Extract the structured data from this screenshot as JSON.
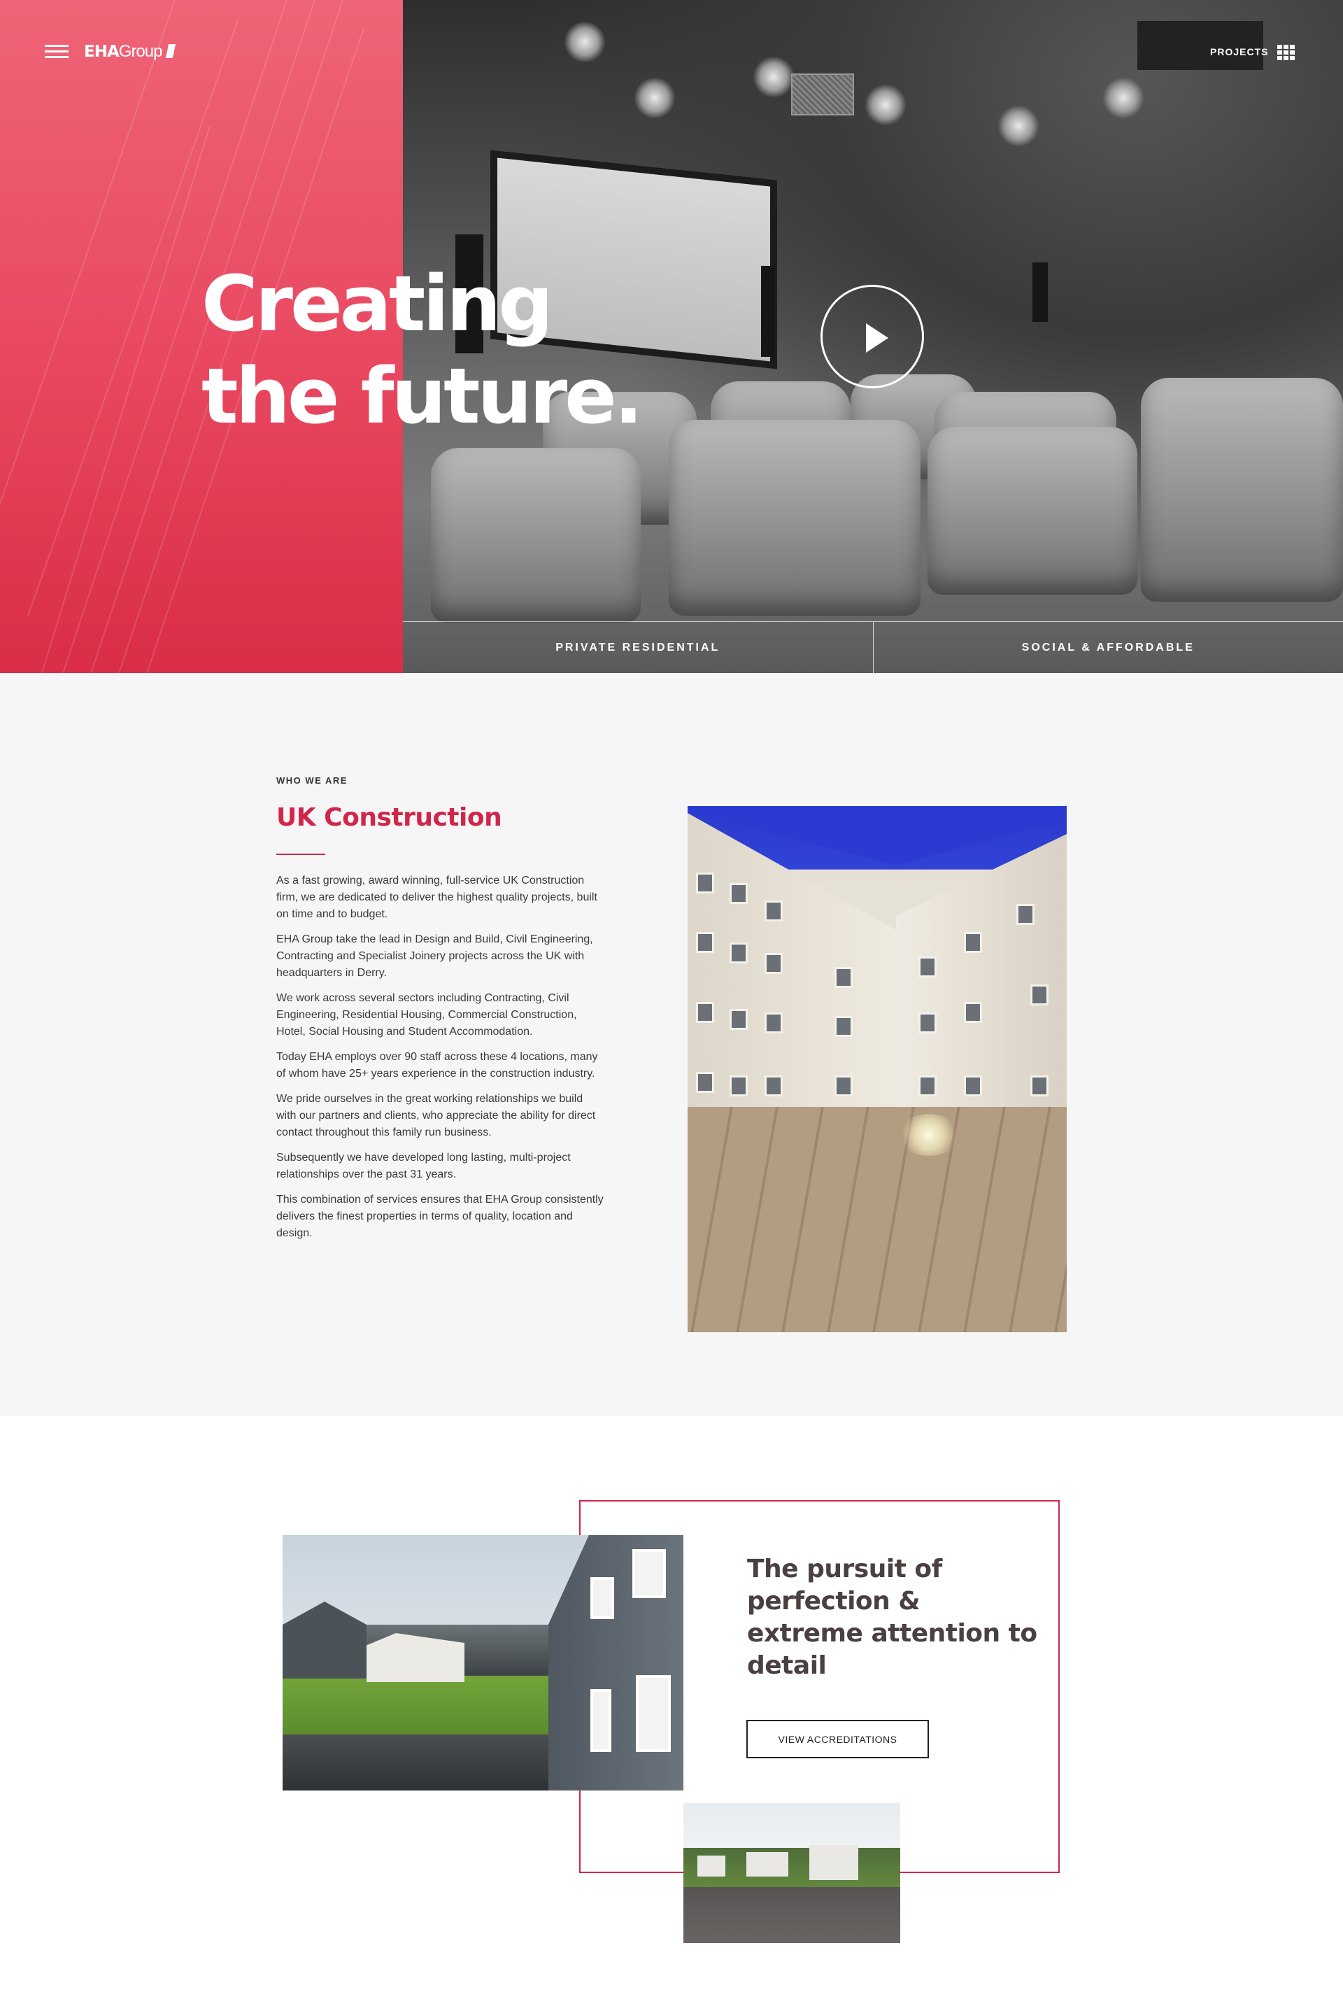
{
  "header": {
    "logo_bold": "EHA",
    "logo_light": "Group",
    "projects_label": "PROJECTS"
  },
  "hero": {
    "title_line1": "Creating",
    "title_line2": "the future.",
    "sectors": [
      "PRIVATE RESIDENTIAL",
      "SOCIAL & AFFORDABLE"
    ]
  },
  "about": {
    "kicker": "WHO WE ARE",
    "title": "UK Construction",
    "paragraphs": [
      "As a fast growing, award winning, full-service UK Construction firm, we are dedicated to deliver the highest quality projects, built on time and to budget.",
      "EHA Group take the lead in Design and Build, Civil Engineering, Contracting and Specialist Joinery projects across the UK with headquarters in Derry.",
      "We work across several sectors including Contracting, Civil Engineering, Residential Housing, Commercial Construction, Hotel, Social Housing and Student Accommodation.",
      "Today EHA employs over 90 staff across these 4 locations, many of whom have 25+ years experience in the construction industry.",
      "We pride ourselves in the great working relationships we build with our partners and clients, who appreciate the ability for direct contact throughout this family run business.",
      "Subsequently we have developed long lasting, multi-project relationships over the past 31 years.",
      "This combination of services ensures that EHA Group consistently delivers the finest properties in terms of quality, location and design."
    ]
  },
  "perfection": {
    "heading": "The pursuit of perfection & extreme attention to detail",
    "button_label": "VIEW ACCREDITATIONS"
  },
  "colors": {
    "brand_red": "#d0264a",
    "hero_pink": "#e8475f"
  }
}
